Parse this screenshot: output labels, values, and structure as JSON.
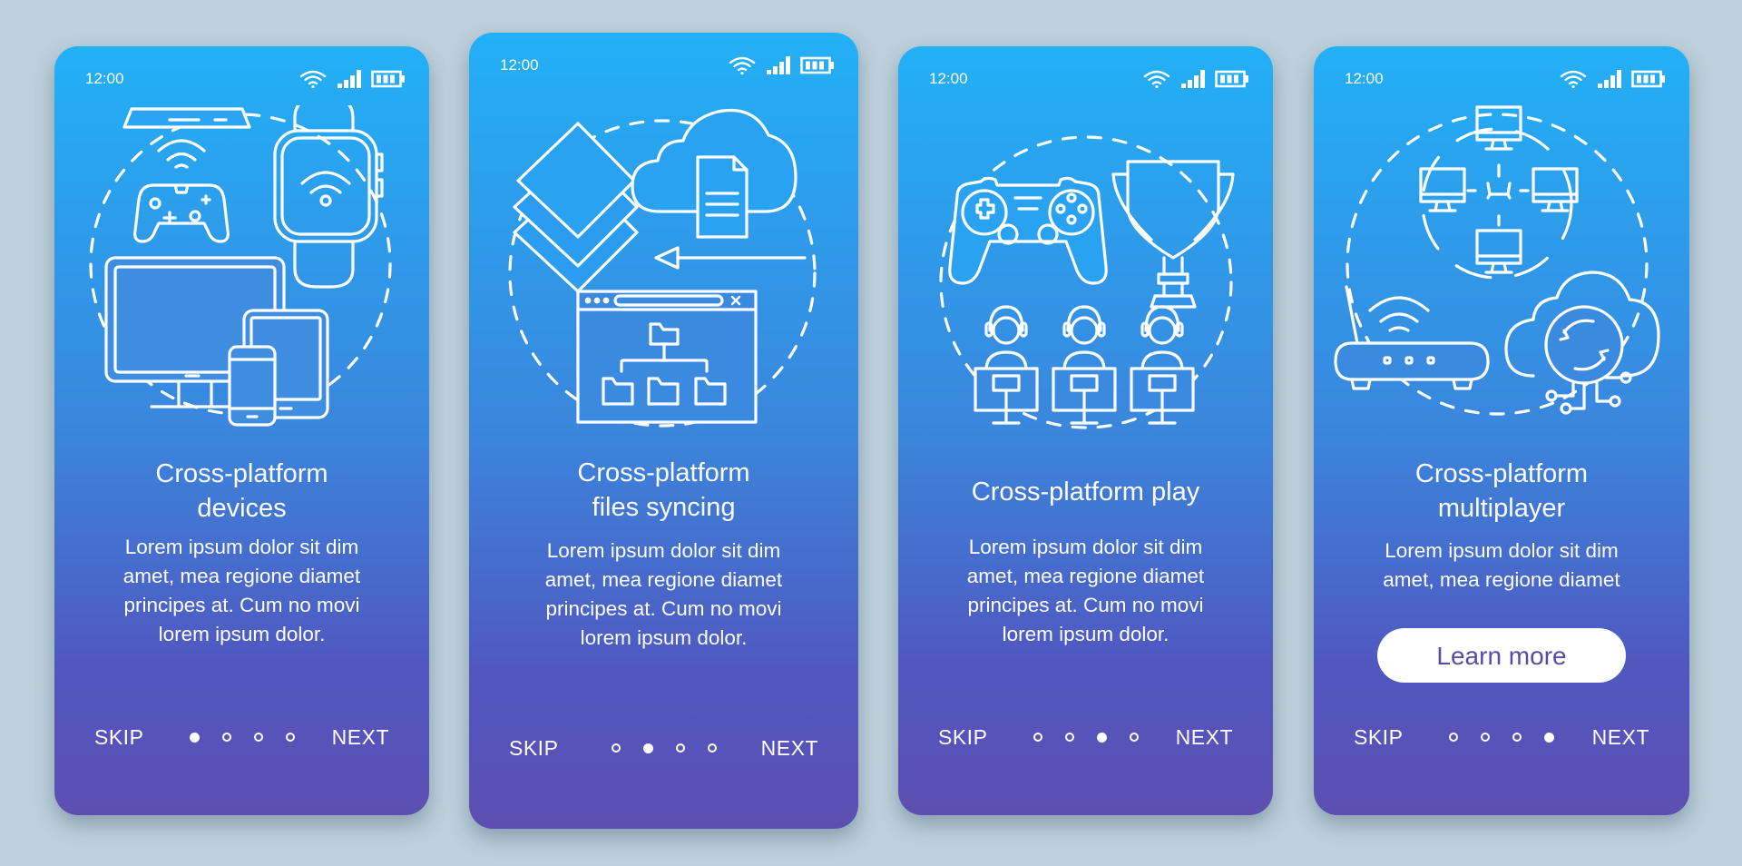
{
  "status_bar": {
    "time": "12:00",
    "icons": [
      "wifi-icon",
      "signal-icon",
      "battery-icon"
    ]
  },
  "nav": {
    "skip_label": "SKIP",
    "next_label": "NEXT",
    "page_count": 4
  },
  "colors": {
    "background": "#bdd0db",
    "gradient_top": "#22b0f7",
    "gradient_bottom": "#5d4fb2",
    "button_text": "#5a4aa8"
  },
  "screens": [
    {
      "title_lines": [
        "Cross-platform",
        "devices"
      ],
      "desc_lines": [
        "Lorem ipsum dolor sit dim",
        "amet, mea regione diamet",
        "principes at. Cum no movi",
        "lorem ipsum dolor."
      ],
      "active_page": 1,
      "illustration": "cross-platform-devices-illustration"
    },
    {
      "title_lines": [
        "Cross-platform",
        "files syncing"
      ],
      "desc_lines": [
        "Lorem ipsum dolor sit dim",
        "amet, mea regione diamet",
        "principes at. Cum no movi",
        "lorem ipsum dolor."
      ],
      "active_page": 2,
      "illustration": "files-syncing-illustration"
    },
    {
      "title_lines": [
        "Cross-platform play"
      ],
      "desc_lines": [
        "Lorem ipsum dolor sit dim",
        "amet, mea regione diamet",
        "principes at. Cum no movi",
        "lorem ipsum dolor."
      ],
      "active_page": 3,
      "illustration": "cross-platform-play-illustration"
    },
    {
      "title_lines": [
        "Cross-platform",
        "multiplayer"
      ],
      "desc_lines": [
        "Lorem ipsum dolor sit dim",
        "amet, mea regione diamet"
      ],
      "active_page": 4,
      "button_label": "Learn more",
      "illustration": "multiplayer-network-illustration"
    }
  ]
}
